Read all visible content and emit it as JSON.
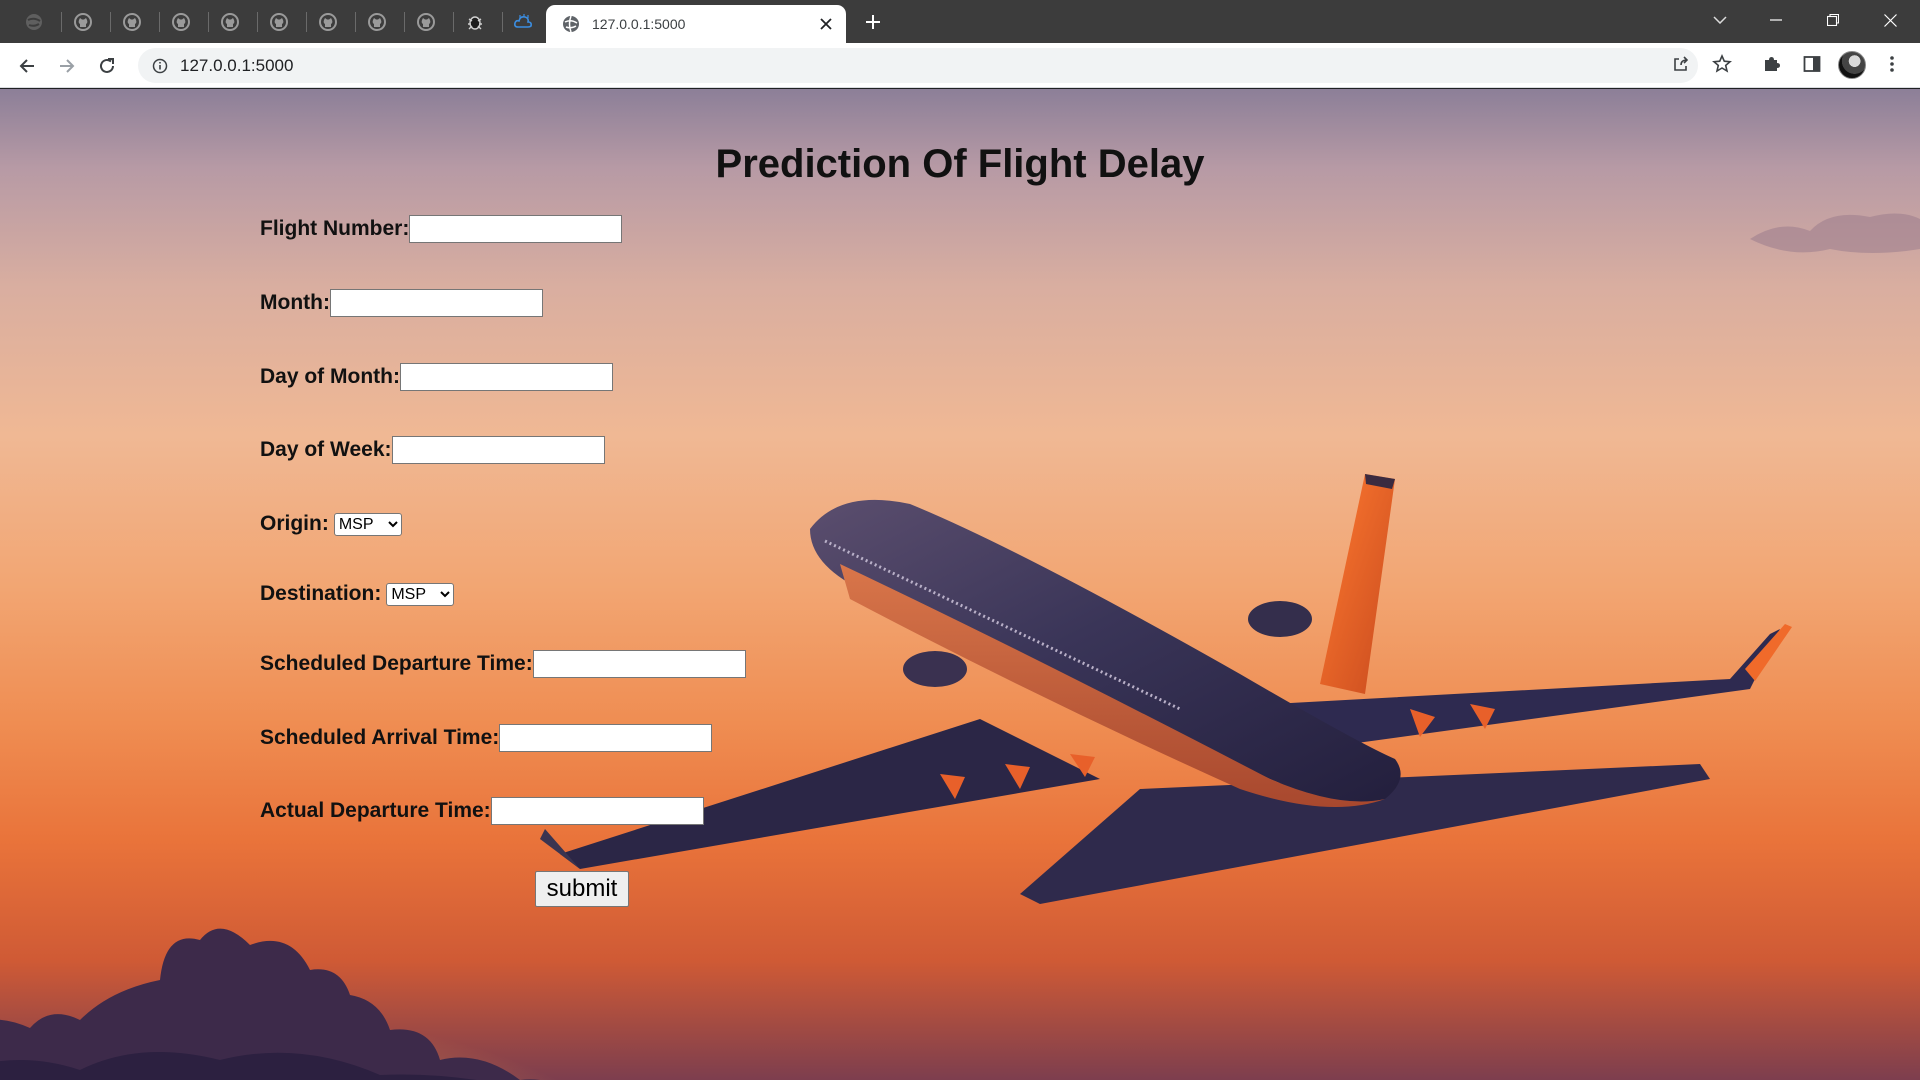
{
  "browser": {
    "active_tab_title": "127.0.0.1:5000",
    "address_url": "127.0.0.1:5000",
    "pinned_tabs": [
      "tab-icon",
      "github-icon",
      "github-icon",
      "github-icon",
      "github-icon",
      "github-icon",
      "github-icon",
      "github-icon",
      "github-icon",
      "bug-icon",
      "cloud-icon"
    ]
  },
  "page": {
    "title": "Prediction Of Flight Delay",
    "fields": {
      "flight_number": {
        "label": "Flight Number:",
        "value": ""
      },
      "month": {
        "label": "Month:",
        "value": ""
      },
      "day_of_month": {
        "label": "Day of Month:",
        "value": ""
      },
      "day_of_week": {
        "label": "Day of Week:",
        "value": ""
      },
      "origin": {
        "label": "Origin:",
        "selected": "MSP"
      },
      "destination": {
        "label": "Destination:",
        "selected": "MSP"
      },
      "scheduled_departure": {
        "label": "Scheduled Departure Time:",
        "value": ""
      },
      "scheduled_arrival": {
        "label": "Scheduled Arrival Time:",
        "value": ""
      },
      "actual_departure": {
        "label": "Actual Departure Time:",
        "value": ""
      }
    },
    "submit_label": "submit"
  },
  "colors": {
    "tabstrip": "#3c3c3c",
    "sky_top": "#8c7f98",
    "sky_bottom": "#e9733a",
    "plane_body": "#2e2b4f",
    "plane_tail": "#f06a2a"
  }
}
